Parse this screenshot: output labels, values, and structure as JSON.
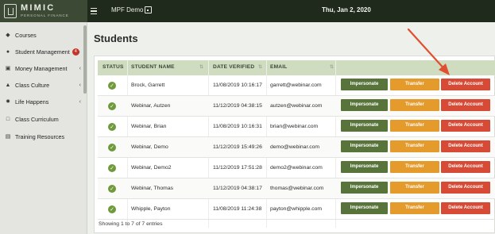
{
  "app": {
    "logo_name": "MIMIC",
    "logo_sub": "PERSONAL FINANCE",
    "demo_label": "MPF Demo",
    "date": "Thu, Jan 2, 2020"
  },
  "sidebar": {
    "items": [
      {
        "label": "Courses",
        "icon": "graduation-cap-icon"
      },
      {
        "label": "Student Management",
        "icon": "user-icon",
        "badge": "4"
      },
      {
        "label": "Money Management",
        "icon": "money-icon"
      },
      {
        "label": "Class Culture",
        "icon": "location-icon"
      },
      {
        "label": "Life Happens",
        "icon": "gear-icon"
      },
      {
        "label": "Class Curriculum",
        "icon": "folder-icon"
      },
      {
        "label": "Training Resources",
        "icon": "document-icon"
      }
    ]
  },
  "page": {
    "title": "Students"
  },
  "table": {
    "columns": [
      "STATUS",
      "STUDENT NAME",
      "DATE VERIFIED",
      "EMAIL"
    ],
    "actions": {
      "impersonate": "Impersonate",
      "transfer": "Transfer",
      "delete": "Delete Account"
    },
    "rows": [
      {
        "name": "Brock, Garrett",
        "date": "11/08/2019 10:16:17",
        "email": "garrett@webinar.com"
      },
      {
        "name": "Webinar, Autzen",
        "date": "11/12/2019 04:38:15",
        "email": "autzen@webinar.com"
      },
      {
        "name": "Webinar, Brian",
        "date": "11/08/2019 10:16:31",
        "email": "brian@webinar.com"
      },
      {
        "name": "Webinar, Demo",
        "date": "11/12/2019 15:49:26",
        "email": "demo@webinar.com"
      },
      {
        "name": "Webinar, Demo2",
        "date": "11/12/2019 17:51:28",
        "email": "demo2@webinar.com"
      },
      {
        "name": "Webinar, Thomas",
        "date": "11/12/2019 04:38:17",
        "email": "thomas@webinar.com"
      },
      {
        "name": "Whipple, Payton",
        "date": "11/08/2019 11:24:38",
        "email": "payton@whipple.com"
      }
    ],
    "footer": "Showing 1 to 7 of 7 entries"
  },
  "colors": {
    "topbar": "#1f2a1c",
    "header_row": "#cfdcc0",
    "impersonate": "#58743a",
    "transfer": "#e59a2c",
    "delete": "#d74a36",
    "arrow": "#e0502f"
  }
}
